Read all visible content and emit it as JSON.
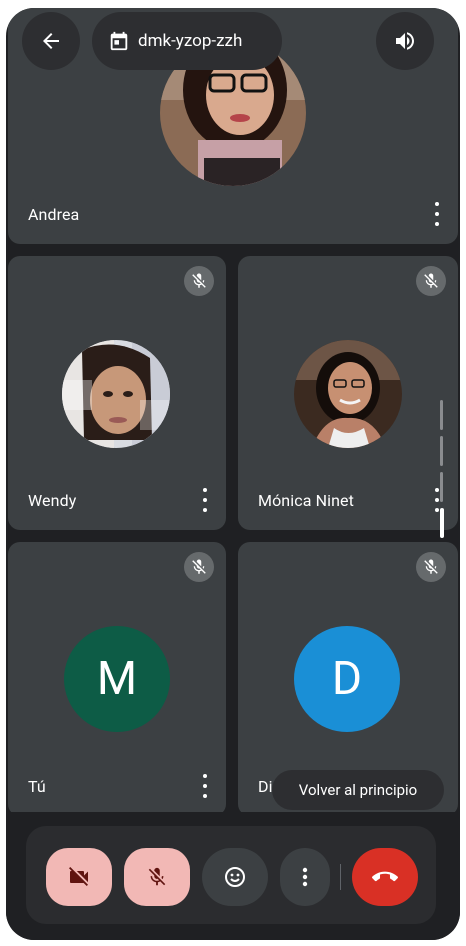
{
  "meeting": {
    "code": "dmk-yzop-zzh"
  },
  "participants": [
    {
      "name": "Andrea",
      "muted": false
    },
    {
      "name": "Wendy",
      "muted": true
    },
    {
      "name": "Mónica Ninet",
      "muted": true
    },
    {
      "name": "Tú",
      "muted": true,
      "initial": "M",
      "color": "#0d5c46"
    },
    {
      "name": "Di",
      "muted": true,
      "initial": "D",
      "color": "#1a8fd6"
    }
  ],
  "tooltip": {
    "text": "Volver al principio"
  },
  "icons": {
    "back": "arrow-left-icon",
    "calendar": "calendar-icon",
    "speaker": "speaker-icon",
    "mic_off": "mic-off-icon",
    "cam_off": "camera-off-icon",
    "reactions": "emoji-icon",
    "more": "more-vert-icon",
    "hangup": "end-call-icon"
  },
  "colors": {
    "background": "#1f2023",
    "tile": "#3c4043",
    "muted_control": "#f2b8b5",
    "hangup": "#d93025"
  }
}
